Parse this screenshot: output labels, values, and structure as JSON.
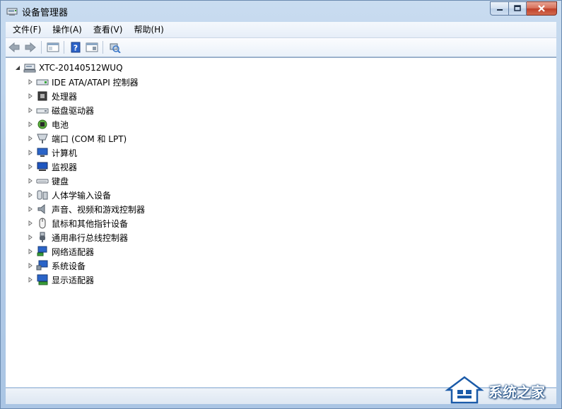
{
  "window": {
    "title": "设备管理器"
  },
  "menu": [
    "文件(F)",
    "操作(A)",
    "查看(V)",
    "帮助(H)"
  ],
  "toolbar": [
    "back-icon",
    "forward-icon",
    "properties-icon",
    "help-icon",
    "console-tree-icon",
    "scan-hardware-icon"
  ],
  "tree": {
    "root": "XTC-20140512WUQ",
    "items": [
      {
        "label": "IDE ATA/ATAPI 控制器",
        "icon": "ide-controller-icon"
      },
      {
        "label": "处理器",
        "icon": "processor-icon"
      },
      {
        "label": "磁盘驱动器",
        "icon": "disk-drive-icon"
      },
      {
        "label": "电池",
        "icon": "battery-icon"
      },
      {
        "label": "端口 (COM 和 LPT)",
        "icon": "port-icon"
      },
      {
        "label": "计算机",
        "icon": "computer-icon"
      },
      {
        "label": "监视器",
        "icon": "monitor-icon"
      },
      {
        "label": "键盘",
        "icon": "keyboard-icon"
      },
      {
        "label": "人体学输入设备",
        "icon": "hid-icon"
      },
      {
        "label": "声音、视频和游戏控制器",
        "icon": "sound-icon"
      },
      {
        "label": "鼠标和其他指针设备",
        "icon": "mouse-icon"
      },
      {
        "label": "通用串行总线控制器",
        "icon": "usb-icon"
      },
      {
        "label": "网络适配器",
        "icon": "network-icon"
      },
      {
        "label": "系统设备",
        "icon": "system-device-icon"
      },
      {
        "label": "显示适配器",
        "icon": "display-adapter-icon"
      }
    ]
  },
  "watermark": {
    "text": "系统之家"
  }
}
